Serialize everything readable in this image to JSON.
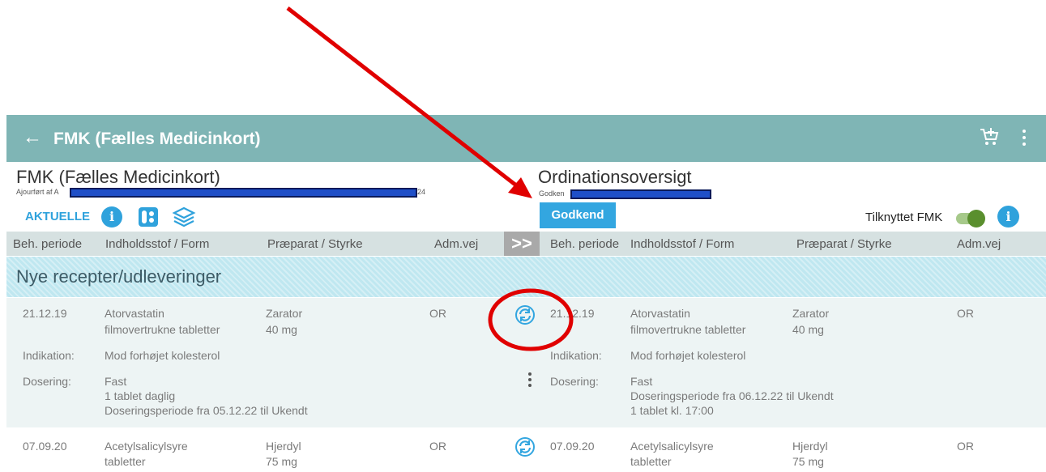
{
  "appbar": {
    "back_icon": "arrow-left-icon",
    "title": "FMK (Fælles Medicinkort)",
    "cart_icon": "cart-plus-icon",
    "menu_icon": "more-vert-icon"
  },
  "left_header": {
    "title": "FMK (Fælles Medicinkort)",
    "updated_prefix": "Ajourført af A",
    "updated_suffix": "24",
    "tab_label": "AKTUELLE"
  },
  "right_header": {
    "title": "Ordinationsoversigt",
    "approved_prefix": "Godken",
    "approve_button": "Godkend",
    "toggle_label": "Tilknyttet FMK",
    "toggle_on": true
  },
  "columns": {
    "left": [
      "Beh. periode",
      "Indholdsstof / Form",
      "Præparat / Styrke",
      "Adm.vej"
    ],
    "right": [
      "Beh. periode",
      "Indholdsstof / Form",
      "Præparat / Styrke",
      "Adm.vej"
    ],
    "expand_label": ">>"
  },
  "section": {
    "title": "Nye recepter/udleveringer"
  },
  "rows": [
    {
      "left": {
        "period": "21.12.19",
        "substance": "Atorvastatin",
        "form": "filmovertrukne tabletter",
        "product": "Zarator",
        "strength": "40 mg",
        "route": "OR",
        "indication_label": "Indikation:",
        "indication": "Mod forhøjet kolesterol",
        "dosing_label": "Dosering:",
        "dosing_lines": [
          "Fast",
          "1 tablet daglig",
          "Doseringsperiode fra 05.12.22 til Ukendt"
        ]
      },
      "right": {
        "period": "21.12.19",
        "substance": "Atorvastatin",
        "form": "filmovertrukne tabletter",
        "product": "Zarator",
        "strength": "40 mg",
        "route": "OR",
        "indication_label": "Indikation:",
        "indication": "Mod forhøjet kolesterol",
        "dosing_label": "Dosering:",
        "dosing_lines": [
          "Fast",
          "Doseringsperiode fra 06.12.22 til Ukendt",
          "1 tablet kl. 17:00"
        ]
      }
    },
    {
      "left": {
        "period": "07.09.20",
        "substance": "Acetylsalicylsyre",
        "form": "tabletter",
        "product": "Hjerdyl",
        "strength": "75 mg",
        "route": "OR"
      },
      "right": {
        "period": "07.09.20",
        "substance": "Acetylsalicylsyre",
        "form": "tabletter",
        "product": "Hjerdyl",
        "strength": "75 mg",
        "route": "OR"
      }
    }
  ],
  "colors": {
    "appbar": "#7fb5b5",
    "accent_blue": "#2fa2dc",
    "annotation_red": "#e00000"
  }
}
